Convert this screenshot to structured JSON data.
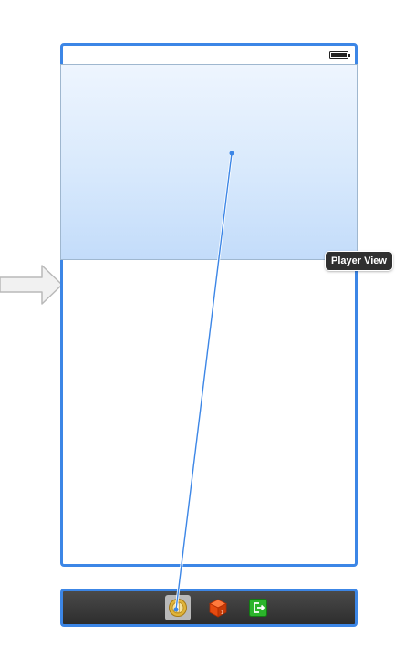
{
  "canvas": {
    "tooltip": "Player View",
    "colors": {
      "selection_border": "#3c86e6",
      "player_view_top": "#eef5fe",
      "player_view_bottom": "#c3dcfa",
      "connection_line": "#3c86e6",
      "dock_background": "#2d2d2d"
    }
  },
  "scene": {
    "status_bar": {
      "battery_icon": "battery-icon"
    },
    "player_view": {
      "selected": true
    }
  },
  "dock": {
    "items": [
      {
        "icon": "view-controller-icon",
        "selected": true
      },
      {
        "icon": "first-responder-icon",
        "selected": false
      },
      {
        "icon": "exit-icon",
        "selected": false
      }
    ]
  }
}
